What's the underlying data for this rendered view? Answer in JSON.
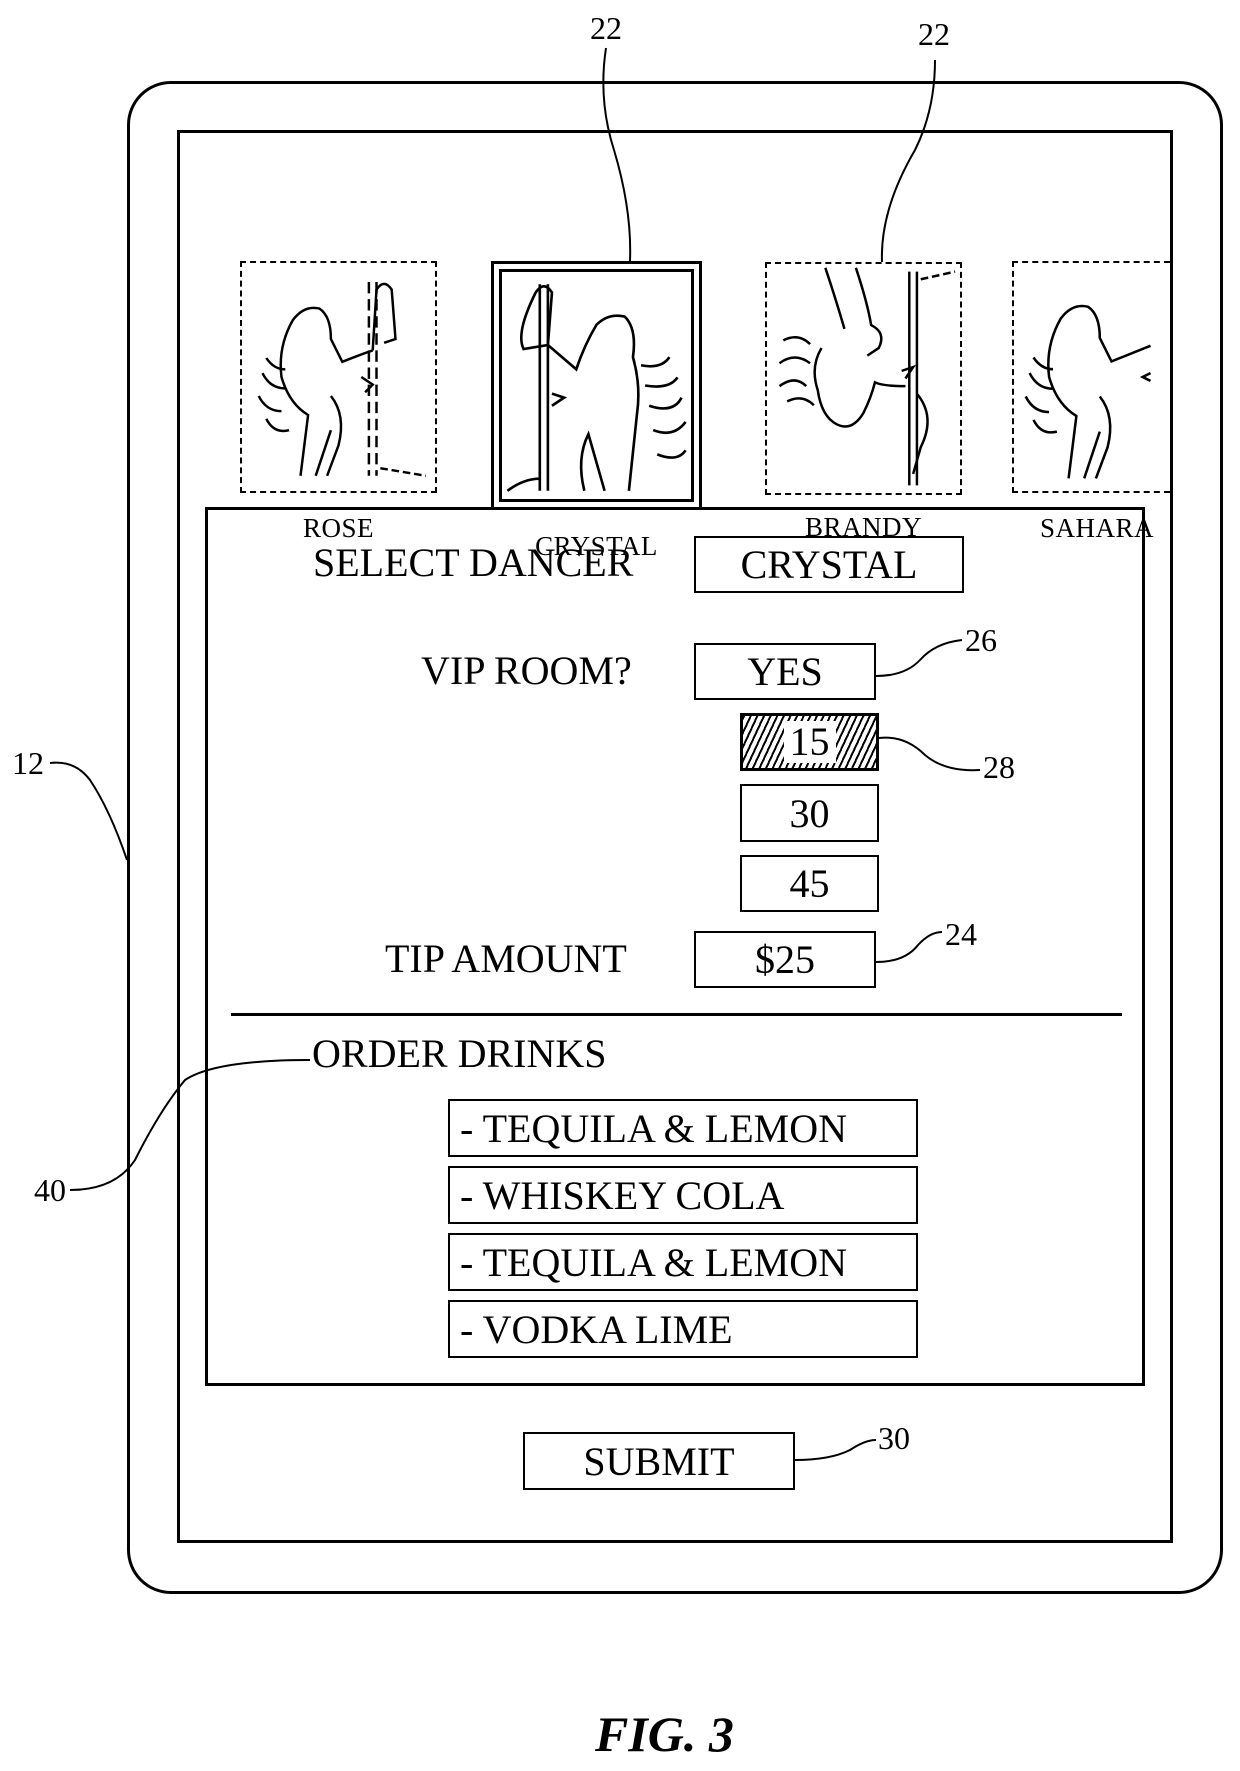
{
  "figure_label": "FIG. 3",
  "reference_numerals": {
    "device": "12",
    "thumbnail_a": "22",
    "thumbnail_b": "22",
    "tip_field": "24",
    "vip_field": "26",
    "duration_selector": "28",
    "submit": "30",
    "order_drinks": "40"
  },
  "dancers": [
    {
      "name": "ROSE",
      "selected": false,
      "icon": "dancer-silhouette-icon"
    },
    {
      "name": "CRYSTAL",
      "selected": true,
      "icon": "dancer-silhouette-icon"
    },
    {
      "name": "BRANDY",
      "selected": false,
      "icon": "dancer-inverted-silhouette-icon"
    },
    {
      "name": "SAHARA",
      "selected": false,
      "icon": "dancer-silhouette-icon"
    }
  ],
  "form": {
    "select_dancer_label": "SELECT DANCER",
    "select_dancer_value": "CRYSTAL",
    "vip_label": "VIP ROOM?",
    "vip_value": "YES",
    "durations": [
      {
        "value": "15",
        "selected": true
      },
      {
        "value": "30",
        "selected": false
      },
      {
        "value": "45",
        "selected": false
      }
    ],
    "tip_label": "TIP AMOUNT",
    "tip_value": "$25"
  },
  "drinks": {
    "heading": "ORDER DRINKS",
    "items": [
      "- TEQUILA & LEMON",
      "- WHISKEY COLA",
      "- TEQUILA & LEMON",
      "- VODKA LIME"
    ]
  },
  "submit_label": "SUBMIT"
}
